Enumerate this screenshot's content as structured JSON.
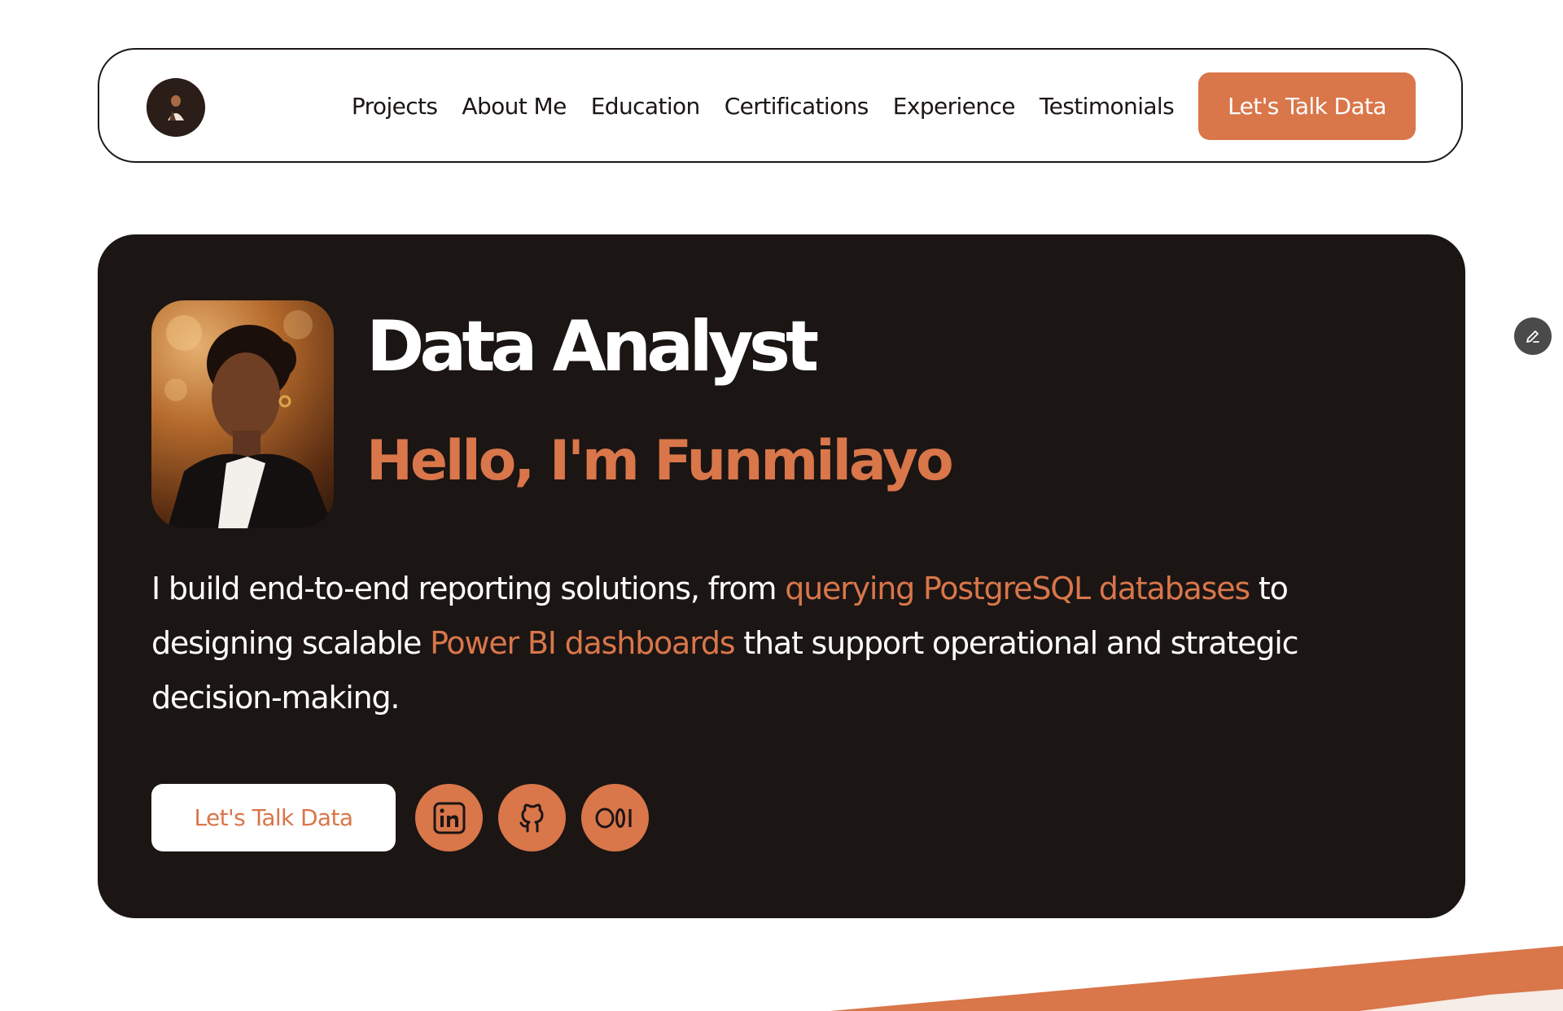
{
  "colors": {
    "accent": "#d9764a",
    "dark": "#1b1514",
    "text": "#1b1614",
    "white": "#ffffff"
  },
  "nav": {
    "logo_icon": "profile-avatar",
    "links": [
      {
        "label": "Projects"
      },
      {
        "label": "About Me"
      },
      {
        "label": "Education"
      },
      {
        "label": "Certifications"
      },
      {
        "label": "Experience"
      },
      {
        "label": "Testimonials"
      }
    ],
    "cta_label": "Let's Talk Data"
  },
  "hero": {
    "portrait_icon": "profile-photo",
    "role": "Data Analyst",
    "greeting": "Hello, I'm Funmilayo",
    "bio": {
      "part1": "I build end-to-end reporting solutions, from ",
      "highlight1": "querying PostgreSQL databases",
      "part2": " to designing scalable ",
      "highlight2": "Power BI dashboards",
      "part3": " that support operational and strategic decision-making."
    },
    "cta_label": "Let's Talk Data",
    "socials": [
      {
        "icon": "linkedin-icon"
      },
      {
        "icon": "github-icon"
      },
      {
        "icon": "medium-icon"
      }
    ]
  },
  "floating": {
    "edit_icon": "pencil-icon"
  }
}
